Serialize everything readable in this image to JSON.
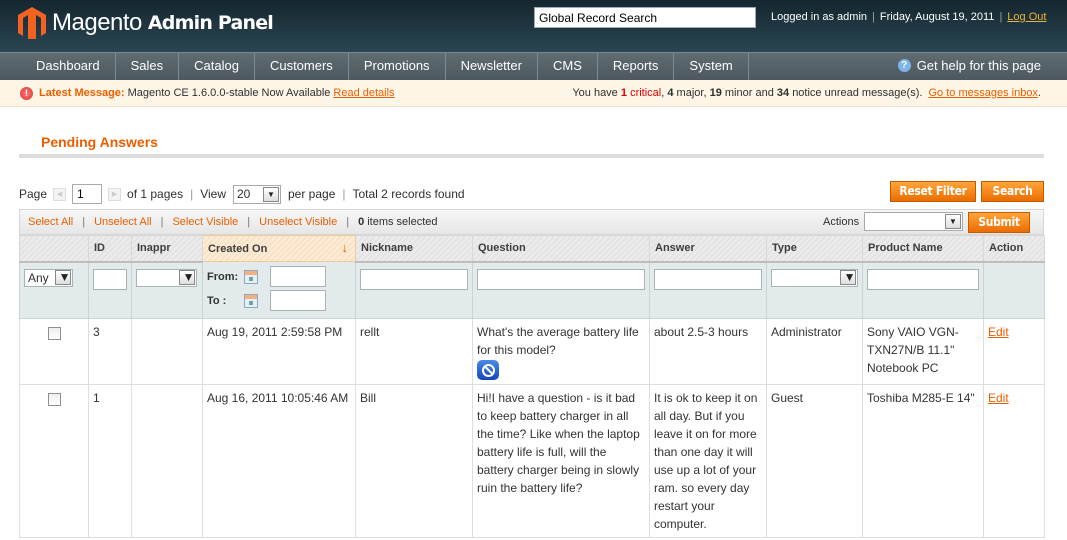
{
  "header": {
    "logo_text": "Magento",
    "logo_sub": "Admin Panel",
    "global_search_value": "Global Record Search",
    "logged_in": "Logged in as admin",
    "date": "Friday, August 19, 2011",
    "logout": "Log Out"
  },
  "nav": {
    "items": [
      "Dashboard",
      "Sales",
      "Catalog",
      "Customers",
      "Promotions",
      "Newsletter",
      "CMS",
      "Reports",
      "System"
    ],
    "help": "Get help for this page"
  },
  "message": {
    "label": "Latest Message:",
    "text": "Magento CE 1.6.0.0-stable Now Available",
    "read_details": "Read details",
    "summary_prefix": "You have",
    "critical_count": "1",
    "critical_label": "critical",
    "major_count": "4",
    "major_label": "major,",
    "minor_count": "19",
    "minor_label": "minor and",
    "notice_count": "34",
    "notice_label": "notice unread message(s).",
    "inbox_link": "Go to messages inbox"
  },
  "page": {
    "title": "Pending Answers"
  },
  "pager": {
    "page_label": "Page",
    "page_value": "1",
    "of_pages": "of 1 pages",
    "view_label": "View",
    "per_page_value": "20",
    "per_page_label": "per page",
    "total": "Total 2 records found",
    "reset_filter": "Reset Filter",
    "search": "Search"
  },
  "massaction": {
    "select_all": "Select All",
    "unselect_all": "Unselect All",
    "select_visible": "Select Visible",
    "unselect_visible": "Unselect Visible",
    "selected_count": "0",
    "selected_label": "items selected",
    "actions_label": "Actions",
    "actions_value": "",
    "submit": "Submit"
  },
  "grid": {
    "columns": [
      "",
      "ID",
      "Inappr",
      "Created On",
      "Nickname",
      "Question",
      "Answer",
      "Type",
      "Product Name",
      "Action"
    ],
    "sorted_column": "Created On",
    "filters": {
      "select_any": "Any",
      "date_from": "From:",
      "date_to": "To :"
    },
    "rows": [
      {
        "id": "3",
        "inappr": "",
        "created_on": "Aug 19, 2011 2:59:58 PM",
        "nickname": "rellt",
        "question": "What's the average battery life for this model?",
        "answer": "about 2.5-3 hours",
        "type": "Administrator",
        "product_name": "Sony VAIO VGN-TXN27N/B 11.1\" Notebook PC",
        "action": "Edit"
      },
      {
        "id": "1",
        "inappr": "",
        "created_on": "Aug 16, 2011 10:05:46 AM",
        "nickname": "Bill",
        "question": "Hi!I have a question - is it bad to keep battery charger in all the time? Like when the laptop battery life is full, will the battery charger being in slowly ruin the battery life?",
        "answer": "It is ok to keep it on all day. But if you leave it on for more than one day it will use up a lot of your ram. so every day restart your computer.",
        "type": "Guest",
        "product_name": "Toshiba M285-E 14\"",
        "action": "Edit"
      }
    ]
  },
  "colors": {
    "accent": "#eb5e00",
    "header_bg": "#1f3640",
    "nav_bg": "#566268",
    "message_bg": "#fdf6e6",
    "filter_bg": "#dfe9ea",
    "critical": "#dd0000"
  }
}
